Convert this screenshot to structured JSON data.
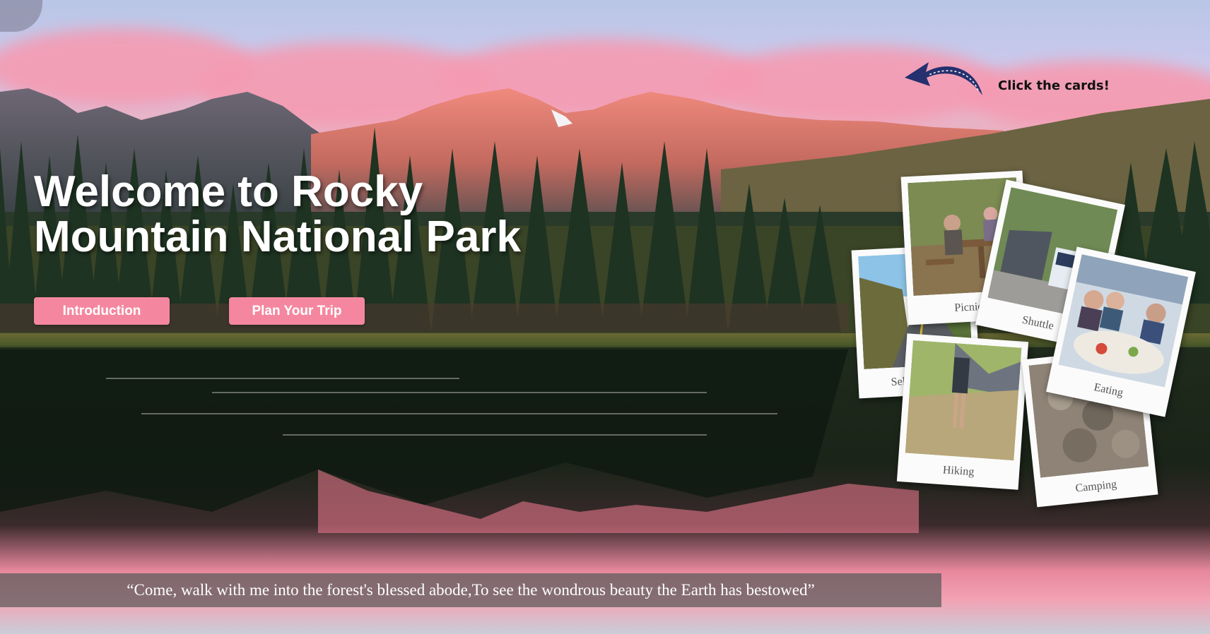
{
  "hero": {
    "title_line1": "Welcome to Rocky",
    "title_line2": "Mountain National Park"
  },
  "nav_buttons": {
    "introduction": "Introduction",
    "plan_trip": "Plan Your Trip"
  },
  "hint": {
    "text": "Click the cards!"
  },
  "cards": [
    {
      "label": "Self Driving"
    },
    {
      "label": "Hiking"
    },
    {
      "label": "Camping"
    },
    {
      "label": "Picnic"
    },
    {
      "label": "Shuttle"
    },
    {
      "label": "Eating"
    }
  ],
  "quote": {
    "text": "“Come, walk with me into the forest's blessed abode,To see the wondrous beauty the Earth has bestowed”"
  },
  "colors": {
    "button_pink": "#f4879f",
    "title_white": "#ffffff",
    "quote_bar": "rgba(90,90,90,0.72)",
    "arrow_navy": "#25306e"
  }
}
